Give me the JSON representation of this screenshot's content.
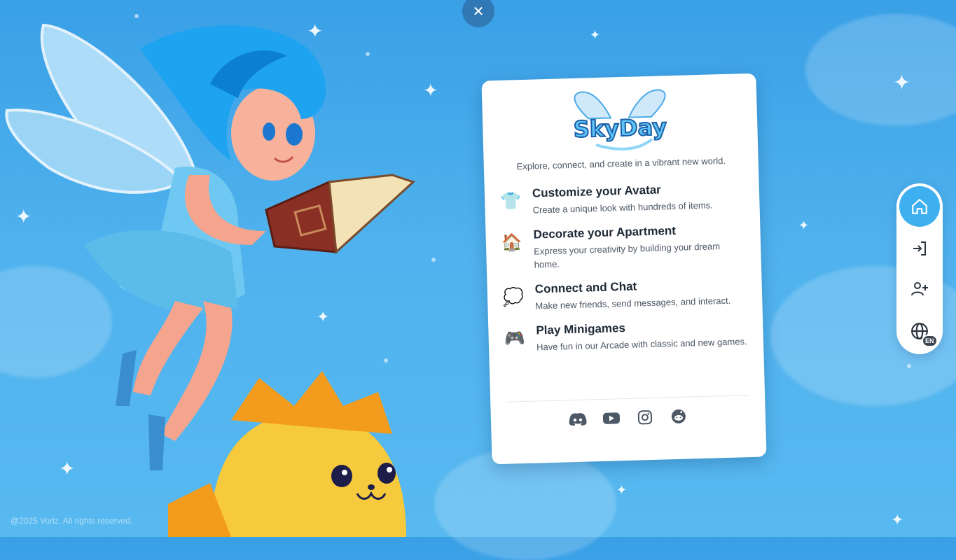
{
  "close": {
    "icon": "close-icon",
    "symbol": "✕"
  },
  "card": {
    "logo_text": "SkyDay",
    "tagline": "Explore, connect, and create in a vibrant new world.",
    "features": [
      {
        "icon": "shirt-icon",
        "emoji": "👕",
        "title": "Customize your Avatar",
        "description": "Create a unique look with hundreds of items."
      },
      {
        "icon": "house-icon",
        "emoji": "🏠",
        "title": "Decorate your Apartment",
        "description": "Express your creativity by building your dream home."
      },
      {
        "icon": "speech-bubble-icon",
        "emoji": "💭",
        "title": "Connect and Chat",
        "description": "Make new friends, send messages, and interact."
      },
      {
        "icon": "gamepad-icon",
        "emoji": "🎮",
        "title": "Play Minigames",
        "description": "Have fun in our Arcade with classic and new games."
      }
    ],
    "socials": [
      "discord-icon",
      "youtube-icon",
      "instagram-icon",
      "reddit-icon"
    ]
  },
  "side_nav": {
    "items": [
      "home-icon",
      "login-icon",
      "add-user-icon",
      "globe-icon"
    ],
    "language": "EN"
  },
  "footer": {
    "copyright": "@2025 Vorlz. All rights reserved."
  },
  "colors": {
    "sky": "#4fb2ee",
    "accent": "#3fb0ef",
    "card": "#ffffff"
  }
}
